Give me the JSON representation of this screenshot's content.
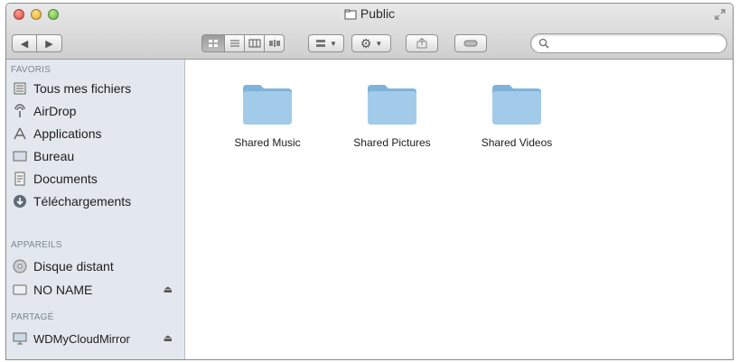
{
  "window": {
    "title": "Public"
  },
  "sidebar": {
    "sections": [
      {
        "heading": "FAVORIS",
        "items": [
          {
            "label": "Tous mes fichiers",
            "icon": "all-files-icon"
          },
          {
            "label": "AirDrop",
            "icon": "airdrop-icon"
          },
          {
            "label": "Applications",
            "icon": "applications-icon"
          },
          {
            "label": "Bureau",
            "icon": "desktop-icon"
          },
          {
            "label": "Documents",
            "icon": "documents-icon"
          },
          {
            "label": "Téléchargements",
            "icon": "downloads-icon"
          }
        ]
      },
      {
        "heading": "APPAREILS",
        "items": [
          {
            "label": "Disque distant",
            "icon": "disc-icon"
          },
          {
            "label": "NO NAME",
            "icon": "drive-icon",
            "eject": true
          }
        ]
      },
      {
        "heading": "PARTAGÉ",
        "items": [
          {
            "label": "WDMyCloudMirror",
            "icon": "network-computer-icon",
            "eject": true
          }
        ]
      }
    ]
  },
  "content": {
    "folders": [
      {
        "label": "Shared Music"
      },
      {
        "label": "Shared Pictures"
      },
      {
        "label": "Shared Videos"
      }
    ]
  },
  "colors": {
    "folder": "#8ebfe0",
    "sidebar_bg": "#e3e8ee",
    "section_heading": "#7c8793"
  }
}
